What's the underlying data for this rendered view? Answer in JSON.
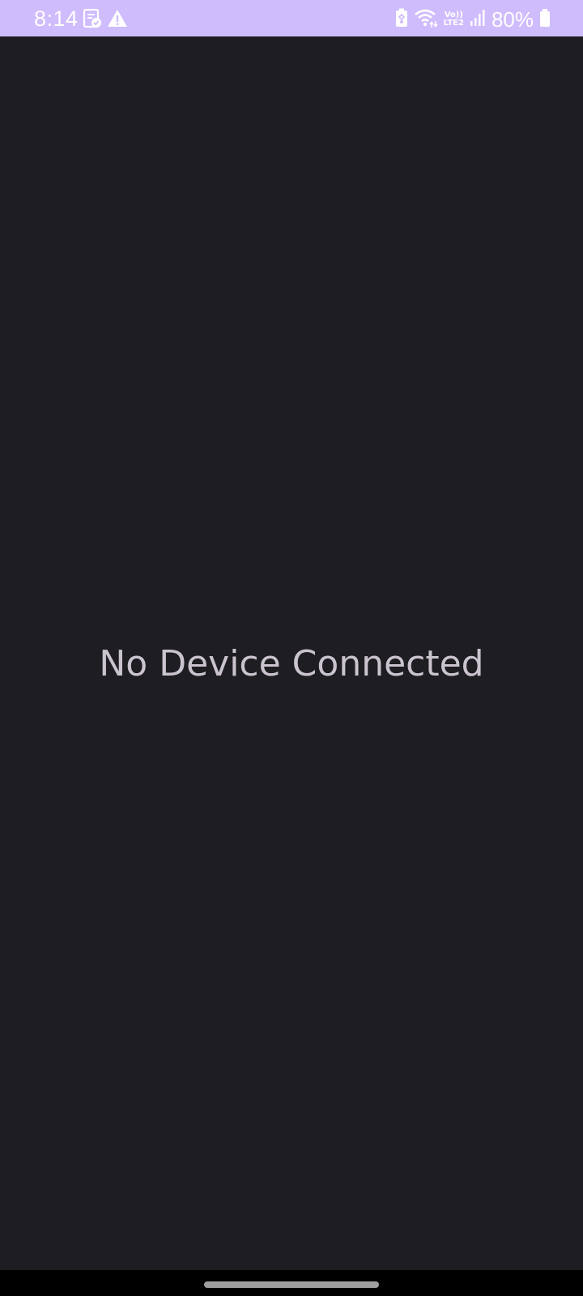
{
  "status_bar": {
    "time": "8:14",
    "battery_percent": "80%",
    "volte_top": "Vo))",
    "volte_bottom": "LTE2",
    "background_color": "#cfbcfc",
    "left_icons": [
      "note-check-icon",
      "warning-icon"
    ],
    "right_icons": [
      "battery-saver-icon",
      "wifi-icon",
      "volte-icon",
      "signal-icon",
      "battery-icon"
    ]
  },
  "main": {
    "empty_message": "No Device Connected",
    "background_color": "#1e1d22",
    "text_color": "#cac4cf"
  },
  "nav_bar": {
    "handle_icon": "home-gesture-handle"
  }
}
